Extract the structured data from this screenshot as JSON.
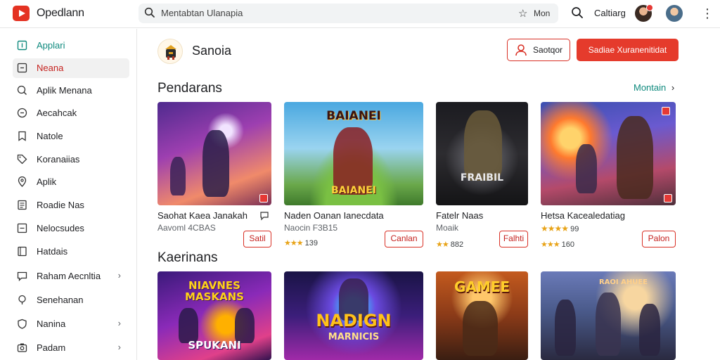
{
  "header": {
    "brand": "Opedlann",
    "search_text": "Mentabtan Ulanapia",
    "search_more": "Mon",
    "account_label": "Caltiarg"
  },
  "sidebar": {
    "items": [
      {
        "label": "Applari",
        "icon": "app-grid-icon"
      },
      {
        "label": "Neana",
        "icon": "square-icon"
      },
      {
        "label": "Aplik Menana",
        "icon": "search-icon"
      },
      {
        "label": "Aecahcak",
        "icon": "circle-icon"
      },
      {
        "label": "Natole",
        "icon": "bookmark-icon"
      },
      {
        "label": "Koranaiias",
        "icon": "tag-icon"
      },
      {
        "label": "Aplik",
        "icon": "location-icon"
      },
      {
        "label": "Roadie Nas",
        "icon": "document-icon"
      },
      {
        "label": "Nelocsudes",
        "icon": "note-icon"
      },
      {
        "label": "Hatdais",
        "icon": "book-icon"
      },
      {
        "label": "Raham Aecnltia",
        "icon": "chat-icon"
      },
      {
        "label": "Senehanan",
        "icon": "location-pin-icon"
      },
      {
        "label": "Nanina",
        "icon": "shield-icon"
      },
      {
        "label": "Padam",
        "icon": "camera-icon"
      }
    ]
  },
  "app": {
    "name": "Sanoia",
    "secondary_button": "Saotqor",
    "primary_button": "Sadiae Xuranenitidat"
  },
  "sections": [
    {
      "title": "Pendarans",
      "more": "Montain",
      "cards": [
        {
          "title": "Saohat Kaea Janakah",
          "sub": "Aavoml 4CBAS",
          "rating": "",
          "button": "Satil",
          "art": "g1"
        },
        {
          "title": "Naden Oanan Ianecdata",
          "sub": "Naocin F3B15",
          "rating": "139",
          "stars": "★★★",
          "button": "Canlan",
          "art": "g2",
          "art_text": "BAIANEI"
        },
        {
          "title": "Fatelr Naas",
          "sub": "Moaik",
          "rating": "882",
          "stars": "★★",
          "button": "Falhti",
          "art": "g3",
          "art_text": "FRAIBIL"
        },
        {
          "title": "Hetsa Kacealedatiag",
          "sub": "",
          "rating": "99",
          "stars": "★★★★",
          "button": "Palon",
          "art": "g4"
        }
      ]
    },
    {
      "title": "Kaerinans",
      "cards": [
        {
          "art": "g5",
          "art_text": "NIAVNES MASKANS",
          "art_text2": "SPUKANI"
        },
        {
          "art": "g6",
          "art_text": "NADIGN",
          "art_text2": "MARNICIS"
        },
        {
          "art": "g7",
          "art_text": "GAMEE"
        },
        {
          "art": "g8",
          "art_text": "RAOI AHUEE"
        }
      ]
    }
  ],
  "colors": {
    "accent_red": "#e53b2c",
    "accent_teal": "#0f8a7e",
    "star": "#e8a317"
  }
}
